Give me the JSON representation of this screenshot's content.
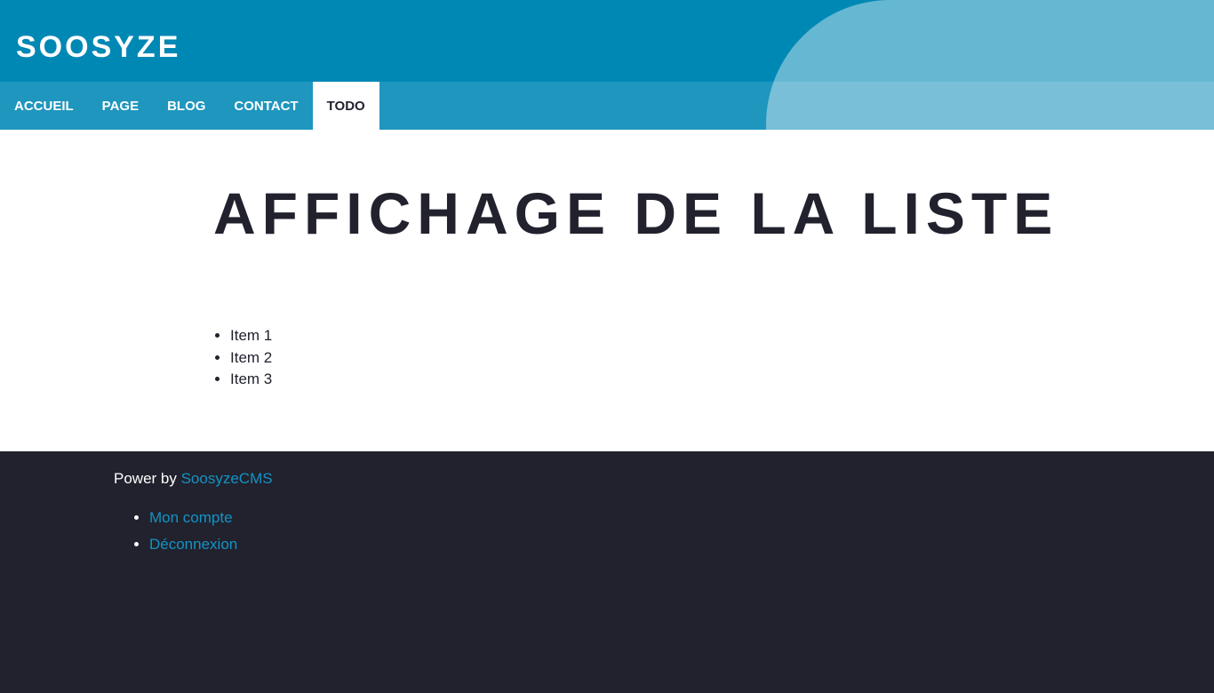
{
  "header": {
    "site_title": "SOOSYZE",
    "nav": [
      {
        "label": "ACCUEIL",
        "active": false
      },
      {
        "label": "PAGE",
        "active": false
      },
      {
        "label": "BLOG",
        "active": false
      },
      {
        "label": "CONTACT",
        "active": false
      },
      {
        "label": "TODO",
        "active": true
      }
    ]
  },
  "main": {
    "title": "AFFICHAGE DE LA LISTE",
    "items": [
      "Item 1",
      "Item 2",
      "Item 3"
    ]
  },
  "footer": {
    "power_prefix": "Power by ",
    "power_link": "SoosyzeCMS",
    "menu": [
      "Mon compte",
      "Déconnexion"
    ]
  },
  "colors": {
    "header_bg": "#0088b5",
    "text_dark": "#21222e",
    "link": "#1393c4",
    "footer_bg": "#21222e"
  }
}
